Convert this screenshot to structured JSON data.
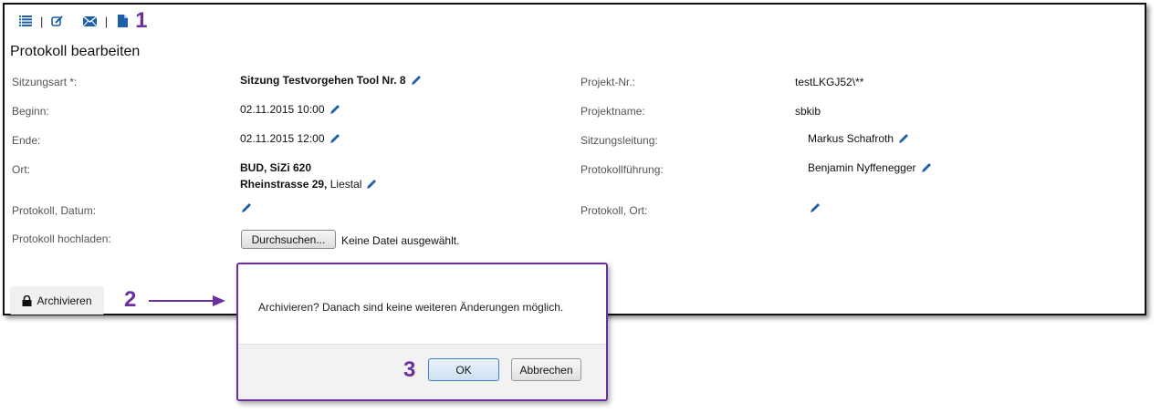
{
  "toolbar": {
    "icons": [
      "list-icon",
      "edit-icon",
      "mail-icon",
      "document-icon"
    ],
    "callout": "1"
  },
  "page_title": "Protokoll bearbeiten",
  "fields": {
    "sitzungsart_label": "Sitzungsart *:",
    "sitzungsart_value": "Sitzung Testvorgehen Tool Nr. 8",
    "beginn_label": "Beginn:",
    "beginn_value": "02.11.2015 10:00",
    "ende_label": "Ende:",
    "ende_value": "02.11.2015 12:00",
    "ort_label": "Ort:",
    "ort_line1": "BUD, SiZi 620",
    "ort_line2_bold": "Rheinstrasse 29,",
    "ort_line2_rest": " Liestal",
    "protokoll_datum_label": "Protokoll, Datum:",
    "protokoll_hochladen_label": "Protokoll hochladen:",
    "projekt_nr_label": "Projekt-Nr.:",
    "projekt_nr_value": "testLKGJ52\\**",
    "projektname_label": "Projektname:",
    "projektname_value": "sbkib",
    "sitzungsleitung_label": "Sitzungsleitung:",
    "sitzungsleitung_value": "Markus Schafroth",
    "protokollfuehrung_label": "Protokollführung:",
    "protokollfuehrung_value": "Benjamin Nyffenegger",
    "protokoll_ort_label": "Protokoll, Ort:"
  },
  "upload": {
    "button_label": "Durchsuchen...",
    "status": "Keine Datei ausgewählt."
  },
  "archive": {
    "button_label": "Archivieren",
    "callout": "2"
  },
  "dialog": {
    "message": "Archivieren? Danach sind keine weiteren Änderungen möglich.",
    "ok_label": "OK",
    "cancel_label": "Abbrechen",
    "callout": "3"
  },
  "colors": {
    "accent_callout": "#6b2fa0",
    "icon_blue": "#1f5fa8"
  }
}
